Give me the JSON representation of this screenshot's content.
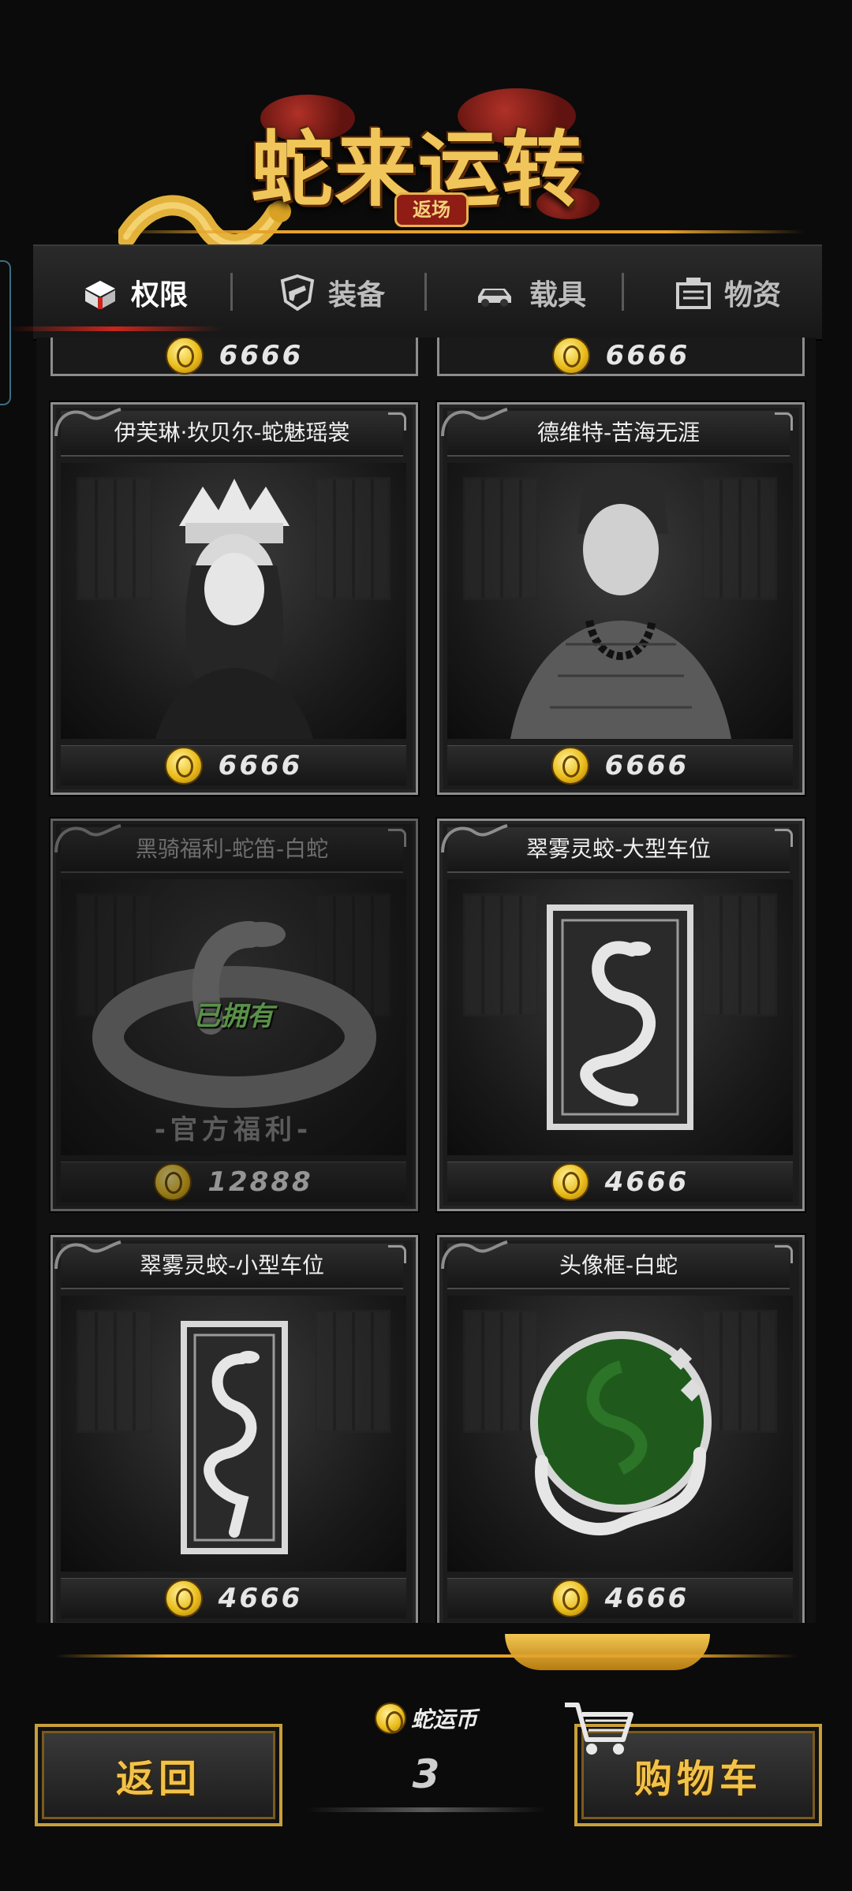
{
  "header": {
    "title": "蛇来运转",
    "badge": "返场"
  },
  "tabs": [
    {
      "label": "权限",
      "icon": "gift-box-icon",
      "active": true
    },
    {
      "label": "装备",
      "icon": "shield-pistol-icon",
      "active": false
    },
    {
      "label": "载具",
      "icon": "car-icon",
      "active": false
    },
    {
      "label": "物资",
      "icon": "supply-crate-icon",
      "active": false
    }
  ],
  "partial_row": [
    {
      "price": "6666"
    },
    {
      "price": "6666"
    }
  ],
  "items": [
    {
      "name": "伊芙琳·坎贝尔-蛇魅瑶裳",
      "price": "6666",
      "icon": "character-portrait-icon"
    },
    {
      "name": "德维特-苦海无涯",
      "price": "6666",
      "icon": "character-portrait-icon"
    },
    {
      "name": "黑骑福利-蛇笛-白蛇",
      "price": "12888",
      "owned_label": "已拥有",
      "tag": "-官方福利-",
      "icon": "snake-icon"
    },
    {
      "name": "翠雾灵蛟-大型车位",
      "price": "4666",
      "icon": "snake-card-icon"
    },
    {
      "name": "翠雾灵蛟-小型车位",
      "price": "4666",
      "icon": "snake-card-icon"
    },
    {
      "name": "头像框-白蛇",
      "price": "4666",
      "icon": "avatar-frame-icon"
    }
  ],
  "footer": {
    "back_label": "返回",
    "cart_label": "购物车",
    "currency_name": "蛇运币",
    "currency_value": "3"
  },
  "colors": {
    "gold": "#f0c65a",
    "accent_red": "#c9261c",
    "owned_green": "#86e06a"
  }
}
